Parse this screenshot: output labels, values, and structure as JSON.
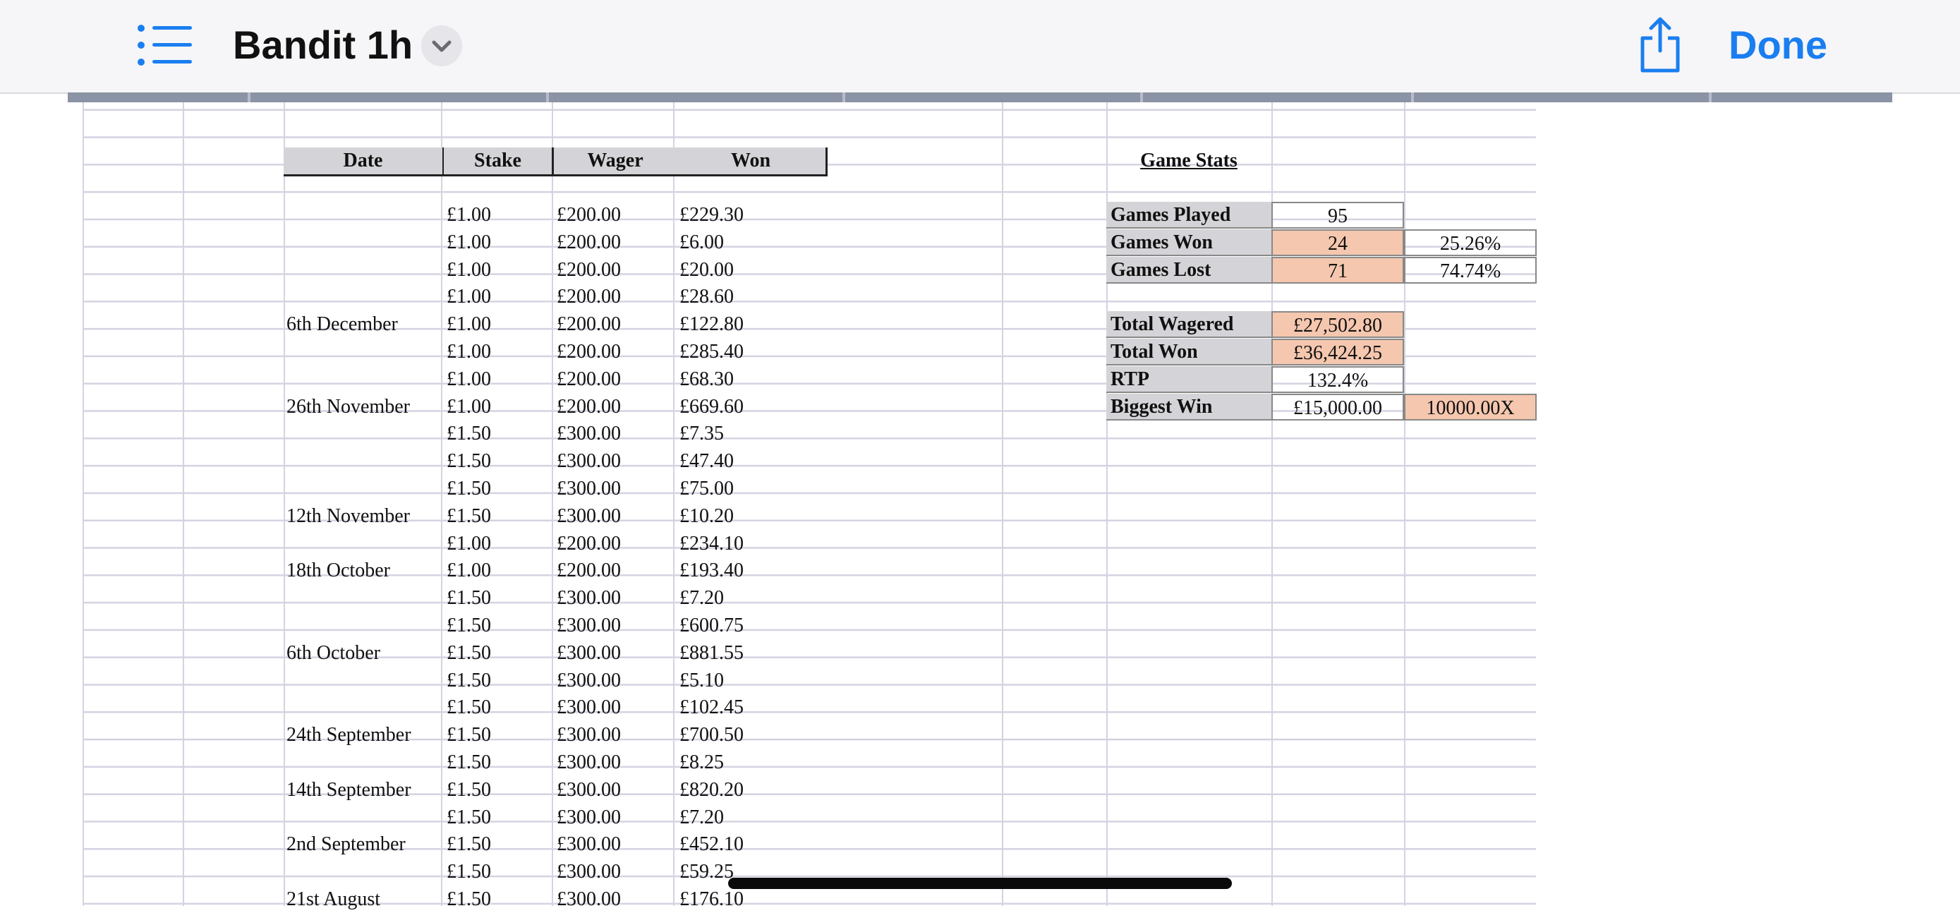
{
  "app": {
    "title": "Bandit 1h",
    "done_label": "Done",
    "icons": {
      "list": "list-icon",
      "chevron": "chevron-down-icon",
      "share": "share-icon"
    },
    "accent_color": "#1a7ef0"
  },
  "table": {
    "headers": [
      "Date",
      "Stake",
      "Wager",
      "Won"
    ],
    "rows": [
      {
        "date": "",
        "stake": "£1.00",
        "wager": "£200.00",
        "won": "£229.30"
      },
      {
        "date": "",
        "stake": "£1.00",
        "wager": "£200.00",
        "won": "£6.00"
      },
      {
        "date": "",
        "stake": "£1.00",
        "wager": "£200.00",
        "won": "£20.00"
      },
      {
        "date": "",
        "stake": "£1.00",
        "wager": "£200.00",
        "won": "£28.60"
      },
      {
        "date": "6th December",
        "stake": "£1.00",
        "wager": "£200.00",
        "won": "£122.80"
      },
      {
        "date": "",
        "stake": "£1.00",
        "wager": "£200.00",
        "won": "£285.40"
      },
      {
        "date": "",
        "stake": "£1.00",
        "wager": "£200.00",
        "won": "£68.30"
      },
      {
        "date": "26th November",
        "stake": "£1.00",
        "wager": "£200.00",
        "won": "£669.60"
      },
      {
        "date": "",
        "stake": "£1.50",
        "wager": "£300.00",
        "won": "£7.35"
      },
      {
        "date": "",
        "stake": "£1.50",
        "wager": "£300.00",
        "won": "£47.40"
      },
      {
        "date": "",
        "stake": "£1.50",
        "wager": "£300.00",
        "won": "£75.00"
      },
      {
        "date": "12th November",
        "stake": "£1.50",
        "wager": "£300.00",
        "won": "£10.20"
      },
      {
        "date": "",
        "stake": "£1.00",
        "wager": "£200.00",
        "won": "£234.10"
      },
      {
        "date": "18th October",
        "stake": "£1.00",
        "wager": "£200.00",
        "won": "£193.40"
      },
      {
        "date": "",
        "stake": "£1.50",
        "wager": "£300.00",
        "won": "£7.20"
      },
      {
        "date": "",
        "stake": "£1.50",
        "wager": "£300.00",
        "won": "£600.75"
      },
      {
        "date": "6th October",
        "stake": "£1.50",
        "wager": "£300.00",
        "won": "£881.55"
      },
      {
        "date": "",
        "stake": "£1.50",
        "wager": "£300.00",
        "won": "£5.10"
      },
      {
        "date": "",
        "stake": "£1.50",
        "wager": "£300.00",
        "won": "£102.45"
      },
      {
        "date": "24th September",
        "stake": "£1.50",
        "wager": "£300.00",
        "won": "£700.50"
      },
      {
        "date": "",
        "stake": "£1.50",
        "wager": "£300.00",
        "won": "£8.25"
      },
      {
        "date": "14th September",
        "stake": "£1.50",
        "wager": "£300.00",
        "won": "£820.20"
      },
      {
        "date": "",
        "stake": "£1.50",
        "wager": "£300.00",
        "won": "£7.20"
      },
      {
        "date": "2nd September",
        "stake": "£1.50",
        "wager": "£300.00",
        "won": "£452.10"
      },
      {
        "date": "",
        "stake": "£1.50",
        "wager": "£300.00",
        "won": "£59.25"
      },
      {
        "date": "21st August",
        "stake": "£1.50",
        "wager": "£300.00",
        "won": "£176.10"
      }
    ]
  },
  "stats": {
    "title": "Game Stats",
    "games_played_label": "Games Played",
    "games_played": "95",
    "games_won_label": "Games Won",
    "games_won": "24",
    "games_won_pct": "25.26%",
    "games_lost_label": "Games Lost",
    "games_lost": "71",
    "games_lost_pct": "74.74%",
    "total_wagered_label": "Total Wagered",
    "total_wagered": "£27,502.80",
    "total_won_label": "Total Won",
    "total_won": "£36,424.25",
    "rtp_label": "RTP",
    "rtp": "132.4%",
    "biggest_win_label": "Biggest Win",
    "biggest_win": "£15,000.00",
    "biggest_win_multiplier": "10000.00X",
    "highlight_color": "#f5c7ae"
  }
}
